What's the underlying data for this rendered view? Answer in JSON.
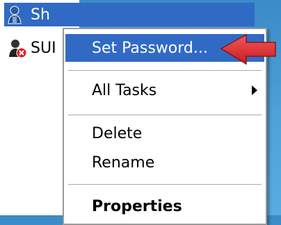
{
  "users": [
    {
      "label": "Sh",
      "icon": "user-icon",
      "selected": true
    },
    {
      "label": "SUI",
      "icon": "disabled-user-icon",
      "selected": false
    }
  ],
  "context_menu": {
    "set_password": "Set Password...",
    "all_tasks": "All Tasks",
    "delete": "Delete",
    "rename": "Rename",
    "properties": "Properties"
  },
  "colors": {
    "highlight": "#316ac5",
    "callout_arrow": "#e0262a",
    "desktop": "#4fa2d8"
  }
}
